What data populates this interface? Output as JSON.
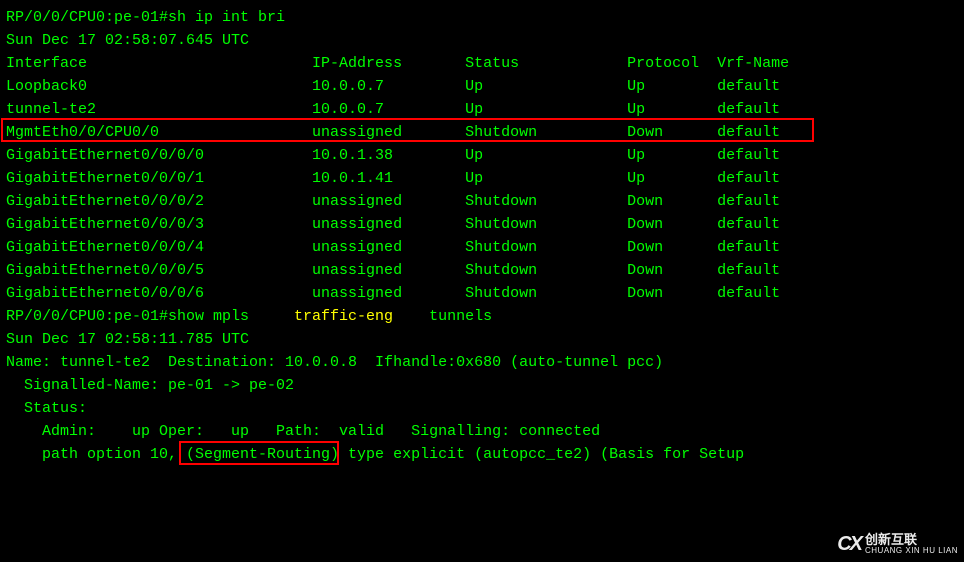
{
  "prompt1": "RP/0/0/CPU0:pe-01#sh ip int bri",
  "timestamp1": "Sun Dec 17 02:58:07.645 UTC",
  "blank": "",
  "headers": {
    "interface": "Interface",
    "ip": "IP-Address",
    "status": "Status",
    "protocol": "Protocol",
    "vrf": "Vrf-Name"
  },
  "rows": [
    {
      "if": "Loopback0",
      "ip": "10.0.0.7",
      "status": "Up",
      "proto": "Up",
      "vrf": "default"
    },
    {
      "if": "tunnel-te2",
      "ip": "10.0.0.7",
      "status": "Up",
      "proto": "Up",
      "vrf": "default"
    },
    {
      "if": "MgmtEth0/0/CPU0/0",
      "ip": "unassigned",
      "status": "Shutdown",
      "proto": "Down",
      "vrf": "default"
    },
    {
      "if": "GigabitEthernet0/0/0/0",
      "ip": "10.0.1.38",
      "status": "Up",
      "proto": "Up",
      "vrf": "default"
    },
    {
      "if": "GigabitEthernet0/0/0/1",
      "ip": "10.0.1.41",
      "status": "Up",
      "proto": "Up",
      "vrf": "default"
    },
    {
      "if": "GigabitEthernet0/0/0/2",
      "ip": "unassigned",
      "status": "Shutdown",
      "proto": "Down",
      "vrf": "default"
    },
    {
      "if": "GigabitEthernet0/0/0/3",
      "ip": "unassigned",
      "status": "Shutdown",
      "proto": "Down",
      "vrf": "default"
    },
    {
      "if": "GigabitEthernet0/0/0/4",
      "ip": "unassigned",
      "status": "Shutdown",
      "proto": "Down",
      "vrf": "default"
    },
    {
      "if": "GigabitEthernet0/0/0/5",
      "ip": "unassigned",
      "status": "Shutdown",
      "proto": "Down",
      "vrf": "default"
    },
    {
      "if": "GigabitEthernet0/0/0/6",
      "ip": "unassigned",
      "status": "Shutdown",
      "proto": "Down",
      "vrf": "default"
    }
  ],
  "prompt2_pre": "RP/0/0/CPU0:pe-01#show mpls",
  "prompt2_mid": "traffic-eng",
  "prompt2_end": "tunnels",
  "timestamp2": "Sun Dec 17 02:58:11.785 UTC",
  "tunnel": {
    "name_line": "Name: tunnel-te2  Destination: 10.0.0.8  Ifhandle:0x680 (auto-tunnel pcc)",
    "sig_label": "  Signalled-Name: ",
    "sig_value": "pe-01 -> pe-02",
    "status_label": "  Status:",
    "admin_line": "    Admin:    up Oper:   up   Path:  valid   Signalling: connected",
    "path_line": "    path option 10, (Segment-Routing) type explicit (autopcc_te2) (Basis for Setup"
  },
  "watermark": {
    "logo": "CX",
    "cn": "创新互联",
    "en": "CHUANG XIN HU LIAN"
  }
}
